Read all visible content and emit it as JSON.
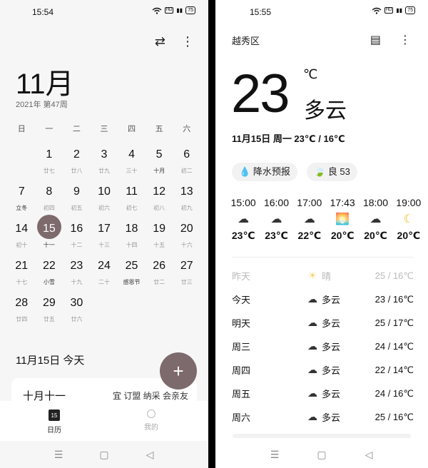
{
  "calendar_screen": {
    "status": {
      "time": "15:54",
      "battery": "75"
    },
    "month_title": "11月",
    "year_week": "2021年 第47周",
    "weekdays": [
      "日",
      "一",
      "二",
      "三",
      "四",
      "五",
      "六"
    ],
    "weeks": [
      [
        {
          "n": "",
          "l": ""
        },
        {
          "n": "1",
          "l": "廿七"
        },
        {
          "n": "2",
          "l": "廿八"
        },
        {
          "n": "3",
          "l": "廿九"
        },
        {
          "n": "4",
          "l": "三十"
        },
        {
          "n": "5",
          "l": "十月"
        },
        {
          "n": "6",
          "l": "初二"
        }
      ],
      [
        {
          "n": "7",
          "l": "立冬"
        },
        {
          "n": "8",
          "l": "初四"
        },
        {
          "n": "9",
          "l": "初五"
        },
        {
          "n": "10",
          "l": "初六"
        },
        {
          "n": "11",
          "l": "初七"
        },
        {
          "n": "12",
          "l": "初八"
        },
        {
          "n": "13",
          "l": "初九"
        }
      ],
      [
        {
          "n": "14",
          "l": "初十"
        },
        {
          "n": "15",
          "l": "十一"
        },
        {
          "n": "16",
          "l": "十二"
        },
        {
          "n": "17",
          "l": "十三"
        },
        {
          "n": "18",
          "l": "十四"
        },
        {
          "n": "19",
          "l": "十五"
        },
        {
          "n": "20",
          "l": "十六"
        }
      ],
      [
        {
          "n": "21",
          "l": "十七"
        },
        {
          "n": "22",
          "l": "小雪"
        },
        {
          "n": "23",
          "l": "十九"
        },
        {
          "n": "24",
          "l": "二十"
        },
        {
          "n": "25",
          "l": "感恩节"
        },
        {
          "n": "26",
          "l": "廿二"
        },
        {
          "n": "27",
          "l": "廿三"
        }
      ],
      [
        {
          "n": "28",
          "l": "廿四"
        },
        {
          "n": "29",
          "l": "廿五"
        },
        {
          "n": "30",
          "l": "廿六"
        },
        {
          "n": "",
          "l": ""
        },
        {
          "n": "",
          "l": ""
        },
        {
          "n": "",
          "l": ""
        },
        {
          "n": "",
          "l": ""
        }
      ]
    ],
    "selected_day": "15",
    "selected_date_label": "11月15日  今天",
    "fab_label": "+",
    "card": {
      "lunar": "十月十一",
      "yi": "宜 订盟 纳采 会亲友"
    },
    "nav": {
      "calendar_label": "日历",
      "calendar_icon_text": "15",
      "me_label": "我的"
    },
    "accent_color": "#7d6a6c"
  },
  "weather_screen": {
    "status": {
      "time": "15:55",
      "battery": "75"
    },
    "district": "越秀区",
    "current_temp": "23",
    "unit": "℃",
    "condition": "多云",
    "date_line": "11月15日 周一    23℃ / 16℃",
    "chips": {
      "rain": "降水预报",
      "aqi": "良 53"
    },
    "hourly": [
      {
        "time": "15:00",
        "icon": "partly-cloudy-sun-icon",
        "temp": "23℃"
      },
      {
        "time": "16:00",
        "icon": "partly-cloudy-sun-icon",
        "temp": "23℃"
      },
      {
        "time": "17:00",
        "icon": "partly-cloudy-sun-icon",
        "temp": "22℃"
      },
      {
        "time": "17:43",
        "icon": "sunset-icon",
        "temp": "20℃"
      },
      {
        "time": "18:00",
        "icon": "partly-cloudy-sun-icon",
        "temp": "20℃"
      },
      {
        "time": "19:00",
        "icon": "moon-icon",
        "temp": "20℃"
      }
    ],
    "daily": [
      {
        "day": "昨天",
        "icon": "sun-icon",
        "cond": "晴",
        "range": "25 / 16℃"
      },
      {
        "day": "今天",
        "icon": "partly-cloudy-sun-icon",
        "cond": "多云",
        "range": "23 / 16℃"
      },
      {
        "day": "明天",
        "icon": "partly-cloudy-sun-icon",
        "cond": "多云",
        "range": "25 / 17℃"
      },
      {
        "day": "周三",
        "icon": "partly-cloudy-sun-icon",
        "cond": "多云",
        "range": "24 / 14℃"
      },
      {
        "day": "周四",
        "icon": "partly-cloudy-sun-icon",
        "cond": "多云",
        "range": "22 / 14℃"
      },
      {
        "day": "周五",
        "icon": "partly-cloudy-sun-icon",
        "cond": "多云",
        "range": "24 / 16℃"
      },
      {
        "day": "周六",
        "icon": "partly-cloudy-sun-icon",
        "cond": "多云",
        "range": "25 / 16℃"
      }
    ]
  }
}
